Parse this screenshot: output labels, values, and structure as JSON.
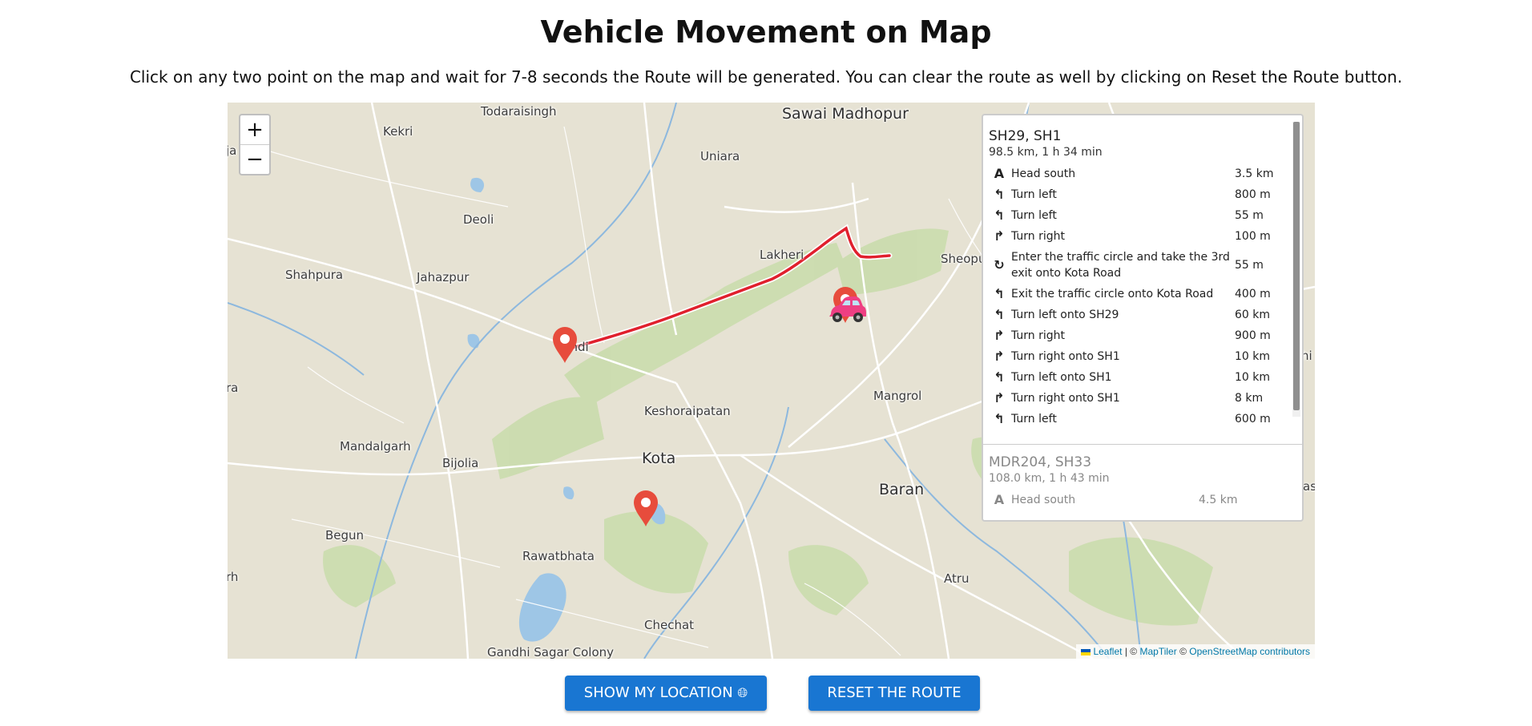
{
  "header": {
    "title": "Vehicle Movement on Map",
    "subtitle": "Click on any two point on the map and wait for 7-8 seconds the Route will be generated. You can clear the route as well by clicking on Reset the Route button."
  },
  "map": {
    "zoom_in_label": "+",
    "zoom_out_label": "−",
    "places": {
      "todaraisingh": "Todaraisingh",
      "sawai_madhopur": "Sawai Madhopur",
      "kekri": "Kekri",
      "uniara": "Uniara",
      "deoli": "Deoli",
      "lakheri": "Lakheri",
      "sheopur": "Sheopu",
      "shahpura": "Shahpura",
      "jahazpur": "Jahazpur",
      "bundi": "undi",
      "keshoraipatan": "Keshoraipatan",
      "mangrol": "Mangrol",
      "mandalgarh": "Mandalgarh",
      "bijolia": "Bijolia",
      "kota": "Kota",
      "baran": "Baran",
      "begun": "Begun",
      "rawatbhata": "Rawatbhata",
      "atru": "Atru",
      "chechat": "Chechat",
      "gandhi_sagar": "Gandhi Sagar Colony",
      "edge_ja": "ja",
      "edge_ra": "ra",
      "edge_rh": "rh",
      "edge_hi": "hi",
      "edge_as": "as"
    },
    "colors": {
      "background": "#e6e2d3",
      "route": "#e0202d",
      "water": "#9ec6e6",
      "forest": "#c5dba6",
      "pin": "#e74c3c",
      "car": "#ee3f83"
    },
    "vehicle_icon": "car-icon",
    "attribution": {
      "leaflet": "Leaflet",
      "separator": "|",
      "copyright1": "©",
      "maptiler": "MapTiler",
      "copyright2": "©",
      "osm": "OpenStreetMap contributors"
    }
  },
  "directions": {
    "primary": {
      "name": "SH29, SH1",
      "summary": "98.5 km, 1 h 34 min",
      "steps": [
        {
          "icon": "depart-icon",
          "text": "Head south",
          "distance": "3.5 km"
        },
        {
          "icon": "turn-left-icon",
          "text": "Turn left",
          "distance": "800 m"
        },
        {
          "icon": "turn-left-icon",
          "text": "Turn left",
          "distance": "55 m"
        },
        {
          "icon": "turn-right-icon",
          "text": "Turn right",
          "distance": "100 m"
        },
        {
          "icon": "roundabout-icon",
          "text": "Enter the traffic circle and take the 3rd exit onto Kota Road",
          "distance": "55 m"
        },
        {
          "icon": "turn-left-icon",
          "text": "Exit the traffic circle onto Kota Road",
          "distance": "400 m"
        },
        {
          "icon": "turn-left-icon",
          "text": "Turn left onto SH29",
          "distance": "60 km"
        },
        {
          "icon": "turn-right-icon",
          "text": "Turn right",
          "distance": "900 m"
        },
        {
          "icon": "turn-right-icon",
          "text": "Turn right onto SH1",
          "distance": "10 km"
        },
        {
          "icon": "turn-left-icon",
          "text": "Turn left onto SH1",
          "distance": "10 km"
        },
        {
          "icon": "turn-right-icon",
          "text": "Turn right onto SH1",
          "distance": "8 km"
        },
        {
          "icon": "turn-left-icon",
          "text": "Turn left",
          "distance": "600 m"
        }
      ]
    },
    "alternative": {
      "name": "MDR204, SH33",
      "summary": "108.0 km, 1 h 43 min",
      "steps": [
        {
          "icon": "depart-icon",
          "text": "Head south",
          "distance": "4.5 km"
        }
      ]
    }
  },
  "buttons": {
    "show_location": "SHOW MY LOCATION",
    "show_location_icon": "globe-icon",
    "reset_route": "RESET THE ROUTE"
  }
}
